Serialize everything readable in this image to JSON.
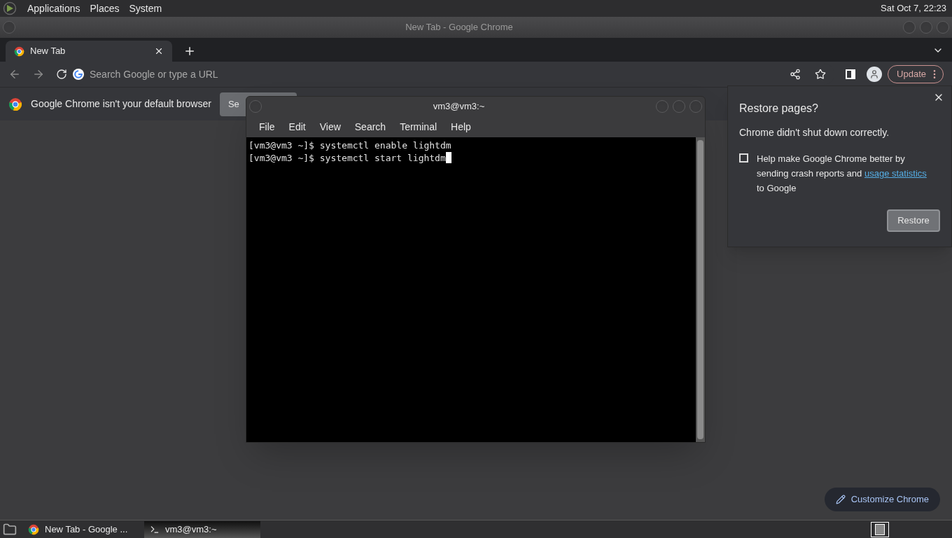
{
  "top_panel": {
    "menus": [
      "Applications",
      "Places",
      "System"
    ],
    "clock": "Sat Oct  7, 22:23"
  },
  "chrome": {
    "window_title": "New Tab - Google Chrome",
    "tabs": [
      {
        "label": "New Tab",
        "selected": true
      }
    ],
    "omnibox": {
      "placeholder": "Search Google or type a URL"
    },
    "update_button": "Update",
    "infobar": {
      "message": "Google Chrome isn't your default browser",
      "button": "Se"
    },
    "customize_button": "Customize Chrome"
  },
  "terminal": {
    "title": "vm3@vm3:~",
    "menus": [
      "File",
      "Edit",
      "View",
      "Search",
      "Terminal",
      "Help"
    ],
    "lines": [
      "[vm3@vm3 ~]$ systemctl enable lightdm",
      "[vm3@vm3 ~]$ systemctl start lightdm"
    ],
    "cursor": true
  },
  "restore_bubble": {
    "title": "Restore pages?",
    "message": "Chrome didn't shut down correctly.",
    "checkbox": {
      "checked": false,
      "text_before": "Help make Google Chrome better by sending crash reports and",
      "link": "usage statistics",
      "text_after": "to Google"
    },
    "button": "Restore"
  },
  "taskbar": {
    "tasks": [
      {
        "kind": "browser",
        "label": "New Tab - Google ...",
        "selected": false
      },
      {
        "kind": "terminal",
        "label": "vm3@vm3:~",
        "selected": true
      }
    ]
  }
}
